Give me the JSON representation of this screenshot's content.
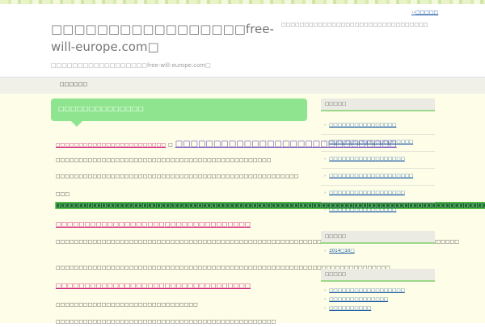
{
  "header": {
    "title": "□□□□□□□□□□□□□□□□□free-will-europe.com□",
    "subtitle": "□□□□□□□□□□□□□□□□□□free-will-europe.com□",
    "description": "□□□□□□□□□□□□□□□□□□□□□□□□□□□□□□□□",
    "top_link": "□□□□□"
  },
  "nav": {
    "items": [
      "□□□□□□"
    ]
  },
  "main": {
    "category_title": "□□□□□□□□□□□□□□",
    "post": {
      "small_title": "□□□□□□□□□□□□□□□□□□□□□□□□",
      "separator": "□",
      "big_title": "□□□□□□□□□□□□□□□□□□□□□□□□□□□□□"
    },
    "paragraphs": [
      "□□□□□□□□□□□□□□□□□□□□□□□□□□□□□□□□□□□□□□□□□□□□□□□",
      "□□□□□□□□□□□□□□□□□□□□□□□□□□□□□□□□□□□□□□□□□□□□□□□□□□□□□"
    ],
    "highlight_prefix": "□□□",
    "highlight_text": "□□□□□□□□□□□□□□□□□□□□□□□□□□□□□□□□□□□□□□□□□□□□□□□□□□□□□□□□□□□□□□□□□□□□□□□□□□□□□□□□□□□□□□□□□□□□□□",
    "link1": "□□□□□□□□□□□□□□□□□□□□□□□□□□□□□□□□□□",
    "paragraphs2": [
      "□□□□□□□□□□□□□□□□□□□□□□□□□□□□□□□□□□□□□□□□□□□□□□□□□□□□□□□□□□□□□□□□□□□□□□□□□□□□□□□□□□□□□□□□",
      "□□□□□□□□□□□□□□□□□□□□□□□□□□□□□□□□□□□□□□□□□□□□□□□□□□□□□□□□□□□□□□□□□□□□□□□□□"
    ],
    "link2": "□□□□□□□□□□□□□□□□□□□□□□□□□□□□□□□□□□",
    "paragraphs3": [
      "□□□□□□□□□□□□□□□□□□□□□□□□□□□□□□□",
      "□□□□□□□□□□□□□□□□□□□□□□□□□□□□□□□□□□□□□□□□□□□□□□□□"
    ]
  },
  "sidebar": {
    "widget1": {
      "title": "□□□□□",
      "items": [
        "□□□□□□□□□□□□□□□□",
        "□□□□□□□□□□□□□□□□□□□□",
        "□□□□□□□□□□□□□□□□□□",
        "□□□□□□□□□□□□□□□□□□□□",
        "□□□□□□□□□□□□□□□□□□",
        "□□□□□□□□□□□□□□□□"
      ]
    },
    "widget2": {
      "title": "□□□□□",
      "items": [
        "2014□10□"
      ]
    },
    "widget3": {
      "title": "□□□□□",
      "items": [
        "□□□□□□□□□□□□□□□□□□",
        "□□□□□□□□□□□□□□",
        "□□□□□□□□□□"
      ]
    }
  }
}
